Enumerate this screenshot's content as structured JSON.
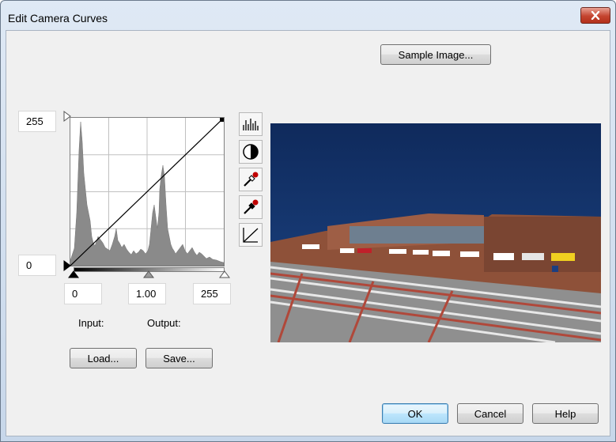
{
  "window": {
    "title": "Edit Camera Curves"
  },
  "buttons": {
    "sample_image": "Sample Image...",
    "load": "Load...",
    "save": "Save...",
    "ok": "OK",
    "cancel": "Cancel",
    "help": "Help"
  },
  "fields": {
    "output_max": "255",
    "output_min": "0",
    "input_low": "0",
    "gamma": "1.00",
    "input_high": "255"
  },
  "labels": {
    "input": "Input:",
    "output": "Output:"
  },
  "tools": [
    {
      "icon": "histogram-icon"
    },
    {
      "icon": "contrast-icon"
    },
    {
      "icon": "eyedropper-icon"
    },
    {
      "icon": "eyedropper-filled-icon"
    },
    {
      "icon": "curve-line-icon"
    }
  ],
  "colors": {
    "sky": "#17386f",
    "brick": "#9b5a3f",
    "histogram": "#8a8a8a"
  }
}
